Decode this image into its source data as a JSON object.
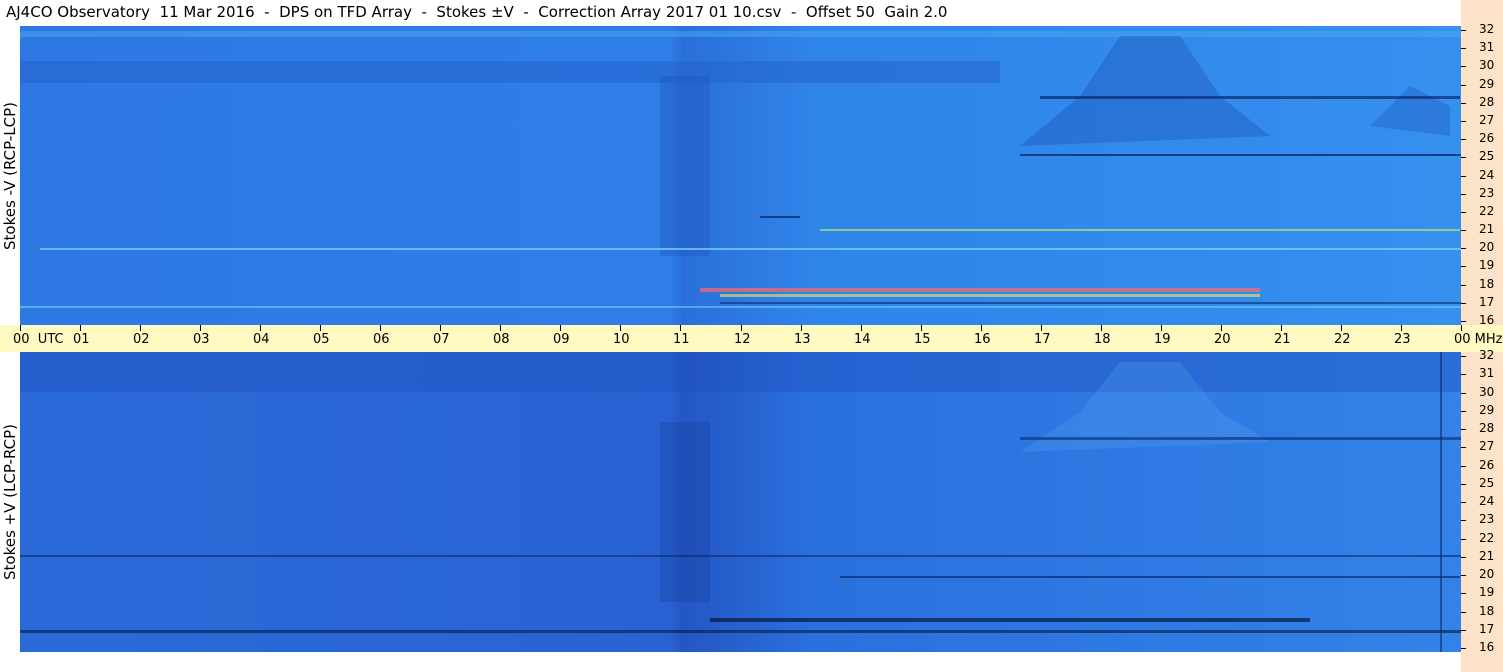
{
  "title": "AJ4CO Observatory  11 Mar 2016  -  DPS on TFD Array  -  Stokes ±V  -  Correction Array 2017 01 10.csv  -  Offset 50  Gain 2.0",
  "panels": {
    "top_label": "Stokes -V (RCP-LCP)",
    "bottom_label": "Stokes +V (LCP-RCP)"
  },
  "time_axis": {
    "labels": [
      "00  UTC",
      "01",
      "02",
      "03",
      "04",
      "05",
      "06",
      "07",
      "08",
      "09",
      "10",
      "11",
      "12",
      "13",
      "14",
      "15",
      "16",
      "17",
      "18",
      "19",
      "20",
      "21",
      "22",
      "23",
      "00 MHz"
    ]
  },
  "freq_axis": {
    "labels": [
      "32",
      "31",
      "30",
      "29",
      "28",
      "27",
      "26",
      "25",
      "24",
      "23",
      "22",
      "21",
      "20",
      "19",
      "18",
      "17",
      "16"
    ]
  },
  "colors": {
    "background_blue": "#2a70dd",
    "time_axis_bg": "#fff9c2",
    "freq_axis_bg": "#fde1c9"
  }
}
